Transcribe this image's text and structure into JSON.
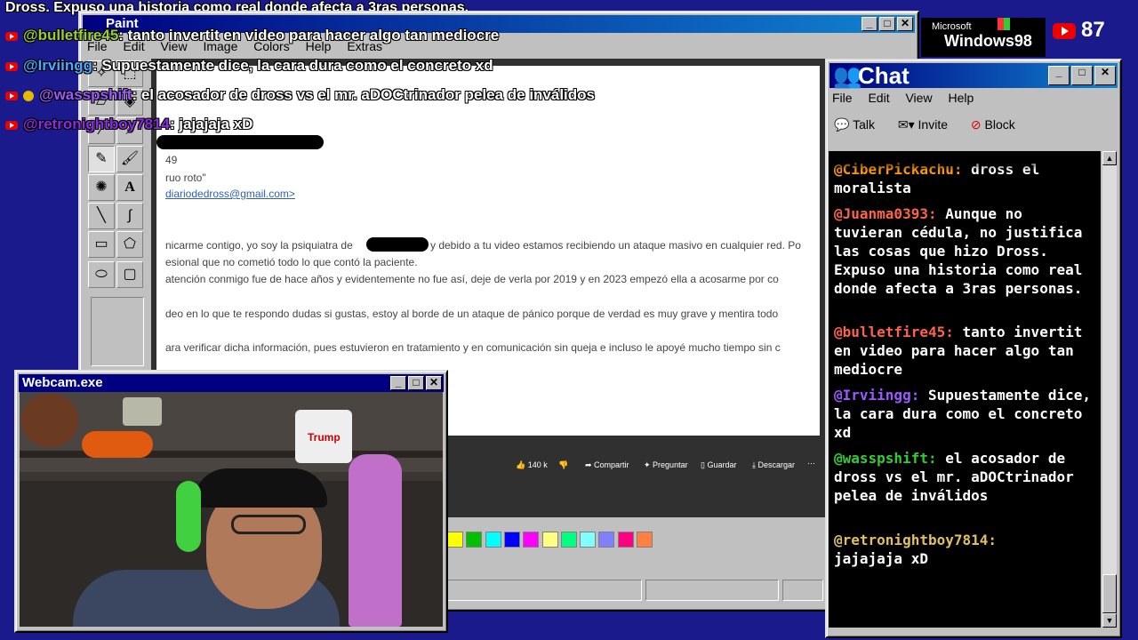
{
  "colors": {
    "desktop": "#1a1a8c",
    "title_gradient_start": "#000080",
    "title_gradient_end": "#1084d0",
    "chat_bg": "#000000"
  },
  "overlay": {
    "top_banner": "Dross. Expuso una historia como real donde afecta a 3ras personas.",
    "viewer_count": "87",
    "logo_line1": "Microsoft",
    "logo_line2": "Windows98",
    "chat_lines": [
      {
        "user": "@bulletfire45",
        "text": ": tanto invertit en video para hacer algo tan mediocre",
        "color": "#9acd32"
      },
      {
        "user": "@Irviingg",
        "text": ": Supuestamente dice, la cara dura como el concreto xd",
        "color": "#4da6ff"
      },
      {
        "user": "@wasspshift",
        "text": ": el acosador de dross vs el mr. aDOCtrinador pelea de inválidos",
        "color": "#9b59ff"
      },
      {
        "user": "@retronightboy7814",
        "text": ": jajajaja xD",
        "color": "#8a2be2"
      }
    ]
  },
  "paint": {
    "title": "Paint",
    "menu": [
      "File",
      "Edit",
      "View",
      "Image",
      "Colors",
      "Help",
      "Extras"
    ],
    "doc_lines": [
      "49",
      "ruo roto\"",
      "diariodedross@gmail.com>",
      "nicarme contigo, yo soy la psiquiatra de",
      "y debido a tu video estamos recibiendo un ataque masivo en cualquier red. Po",
      "esional que no cometió todo lo que contó la paciente.",
      "atención conmigo fue de hace años y evidentemente no fue así, deje de verla por 2019 y en 2023 empezó ella a acosarme por co",
      "deo en lo que te respondo dudas si gustas, estoy al borde de un ataque de pánico porque de  verdad es muy grave y mentira todo",
      "ara verificar dicha información, pues estuvieron en tratamiento y en comunicación sin queja e incluso le apoyé mucho tiempo sin c"
    ],
    "actions": {
      "likes": "140 k",
      "ask": "Preguntar",
      "share": "Compartir",
      "save": "Guardar",
      "download": "Descargar"
    },
    "palette": [
      "#ffff00",
      "#00c000",
      "#00ffff",
      "#0000ff",
      "#ff00ff",
      "#ffff80",
      "#00ff80",
      "#80ffff",
      "#8080ff",
      "#ff0080",
      "#ff8040"
    ]
  },
  "chat": {
    "title": "Chat",
    "menu": [
      "File",
      "Edit",
      "View",
      "Help"
    ],
    "toolbar": {
      "talk": "Talk",
      "invite": "Invite",
      "block": "Block"
    },
    "messages": [
      {
        "user": "@CiberPickachu:",
        "text": " dross el moralista",
        "color": "#ff9900"
      },
      {
        "user": "@Juanma0393:",
        "text": " Aunque no tuvieran cédula, no justifica las cosas que hizo Dross. Expuso una historia como real donde afecta a 3ras personas.",
        "color": "#ff6347"
      },
      {
        "user": "@bulletfire45:",
        "text": " tanto invertit en video para hacer algo tan mediocre",
        "color": "#ff6347"
      },
      {
        "user": "@Irviingg:",
        "text": " Supuestamente dice, la cara dura como el concreto xd",
        "color": "#9b59ff"
      },
      {
        "user": "@wasspshift:",
        "text": " el acosador de dross vs el mr. aDOCtrinador pelea de inválidos",
        "color": "#32cd32"
      },
      {
        "user": "@retronightboy7814:",
        "text": " jajajaja xD",
        "color": "#e0c060"
      }
    ]
  },
  "webcam": {
    "title": "Webcam.exe",
    "paper_label": "Trump"
  }
}
